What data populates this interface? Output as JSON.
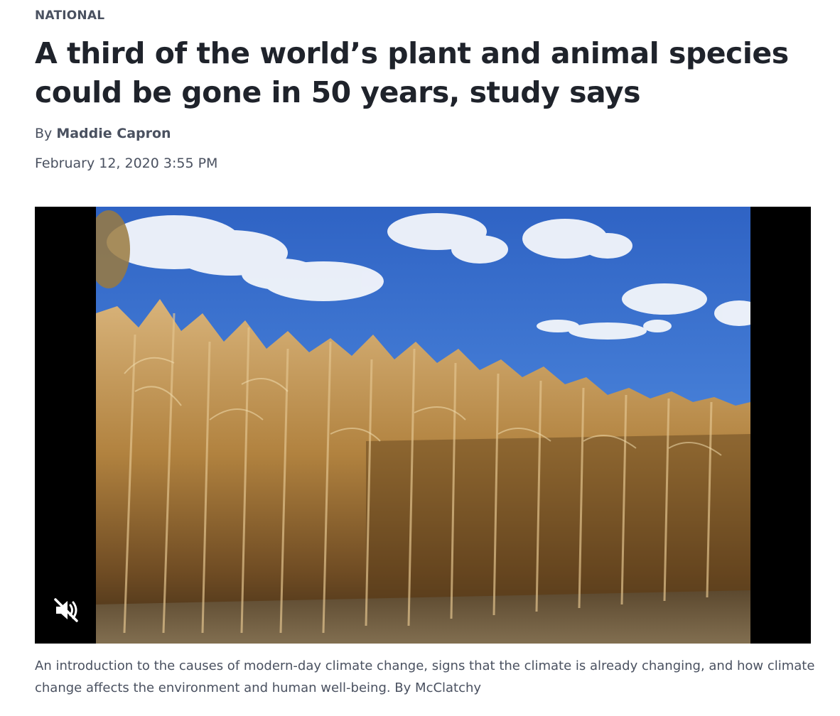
{
  "article": {
    "section": "NATIONAL",
    "headline": "A third of the world’s plant and animal species could be gone in 50 years, study says",
    "byline_prefix": "By",
    "author": "Maddie Capron",
    "date": "February 12, 2020 3:55 PM"
  },
  "video": {
    "mute_icon": "speaker-muted-icon",
    "muted": true,
    "caption": "An introduction to the causes of modern-day climate change, signs that the climate is already changing, and how climate change affects the environment and human well-being. By McClatchy"
  },
  "colors": {
    "text_dark": "#1f232b",
    "text_muted": "#4a5160",
    "video_bg": "#000000",
    "sky": "#3f78d6",
    "corn": "#b58a4a"
  }
}
